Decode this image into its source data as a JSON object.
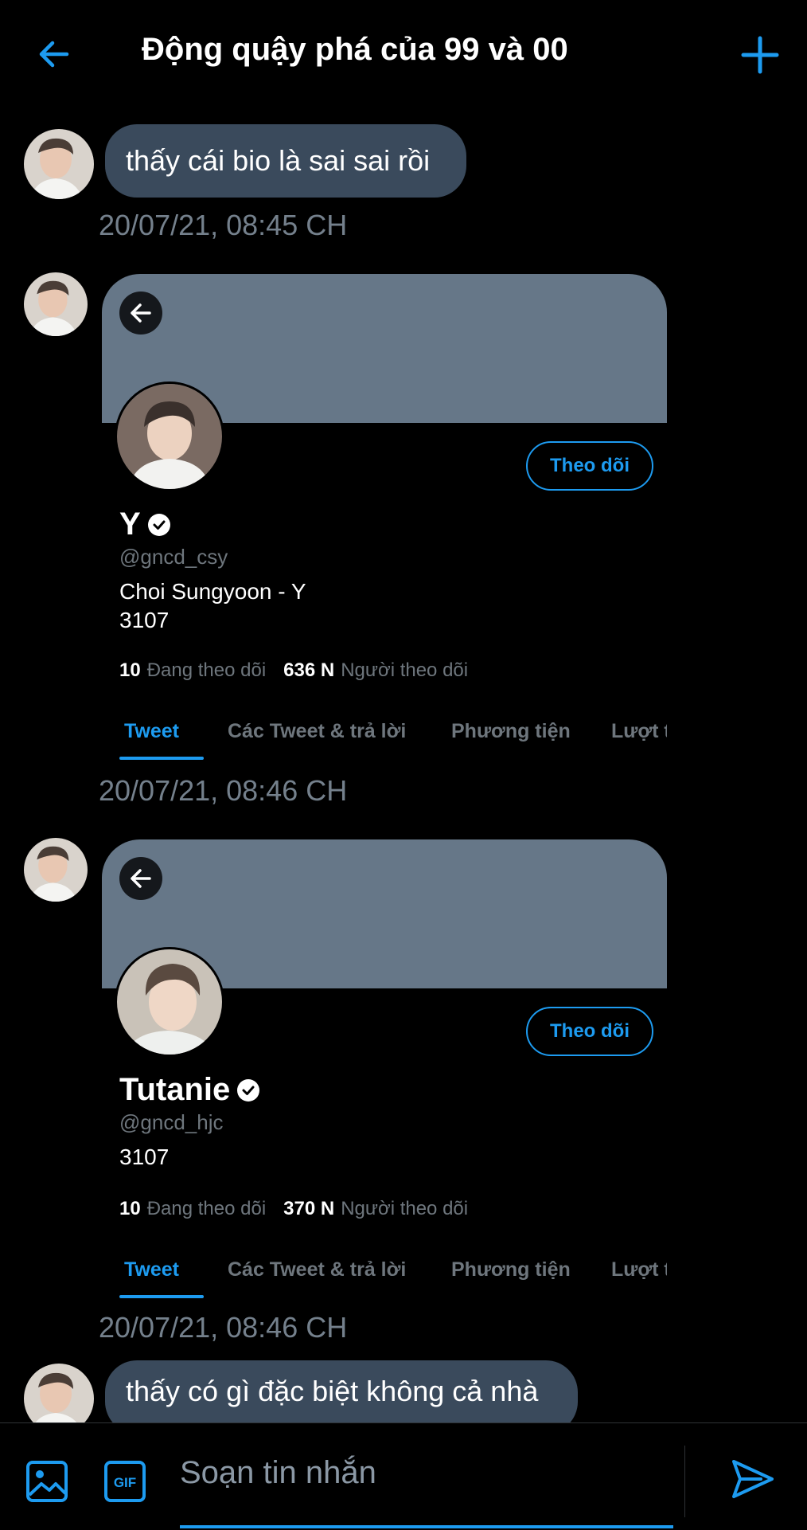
{
  "header": {
    "title": "Động quậy phá của 99 và 00",
    "back_icon": "arrow-left-icon",
    "add_icon": "plus-icon"
  },
  "messages": [
    {
      "type": "text",
      "text": "thấy cái bio là sai sai rồi",
      "timestamp": "20/07/21, 08:45 CH"
    },
    {
      "type": "profile-card",
      "name": "Y",
      "handle": "@gncd_csy",
      "bio": [
        "Choi Sungyoon - Y",
        "3107"
      ],
      "following_count": "10",
      "following_label": "Đang theo dõi",
      "followers_count": "636 N",
      "followers_label": "Người theo dõi",
      "follow_label": "Theo dõi",
      "tabs": [
        "Tweet",
        "Các Tweet & trả lời",
        "Phương tiện",
        "Lượt t"
      ],
      "timestamp": "20/07/21, 08:46 CH"
    },
    {
      "type": "profile-card",
      "name": "Tutanie",
      "handle": "@gncd_hjc",
      "bio": [
        "3107"
      ],
      "following_count": "10",
      "following_label": "Đang theo dõi",
      "followers_count": "370 N",
      "followers_label": "Người theo dõi",
      "follow_label": "Theo dõi",
      "tabs": [
        "Tweet",
        "Các Tweet & trả lời",
        "Phương tiện",
        "Lượt t"
      ],
      "timestamp": "20/07/21, 08:46 CH"
    },
    {
      "type": "text",
      "text": "thấy có gì đặc biệt không cả nhà"
    }
  ],
  "composer": {
    "placeholder": "Soạn tin nhắn",
    "image_icon": "image-icon",
    "gif_label": "GIF",
    "send_icon": "send-icon"
  },
  "colors": {
    "accent": "#1d9bf0",
    "bubble": "#3a4a5c",
    "banner": "#667788",
    "muted": "#6e767d"
  }
}
